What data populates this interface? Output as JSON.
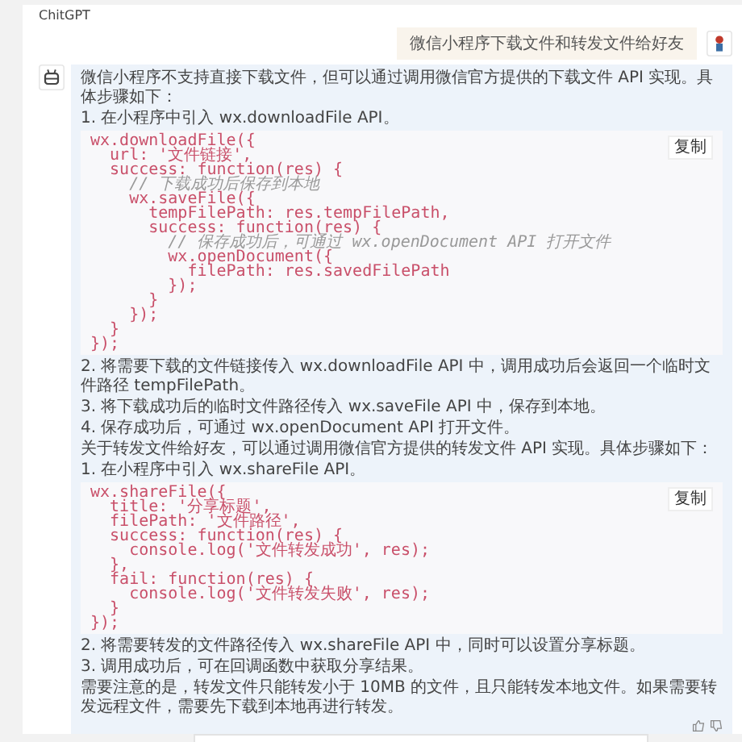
{
  "header": {
    "title": "ChitGPT"
  },
  "user_message": {
    "text": "微信小程序下载文件和转发文件给好友"
  },
  "reply": {
    "blocks": [
      {
        "kind": "text",
        "text": "微信小程序不支持直接下载文件，但可以通过调用微信官方提供的下载文件 API 实现。具体步骤如下："
      },
      {
        "kind": "text",
        "text": "1. 在小程序中引入 wx.downloadFile API。"
      },
      {
        "kind": "code",
        "copy_label": "复制",
        "lines": [
          {
            "kind": "code",
            "text": "wx.downloadFile({"
          },
          {
            "kind": "code",
            "text": "  url: '文件链接',"
          },
          {
            "kind": "code",
            "text": "  success: function(res) {"
          },
          {
            "kind": "comment",
            "text": "    // 下载成功后保存到本地"
          },
          {
            "kind": "code",
            "text": "    wx.saveFile({"
          },
          {
            "kind": "code",
            "text": "      tempFilePath: res.tempFilePath,"
          },
          {
            "kind": "code",
            "text": "      success: function(res) {"
          },
          {
            "kind": "comment",
            "text": "        // 保存成功后，可通过 wx.openDocument API 打开文件"
          },
          {
            "kind": "code",
            "text": "        wx.openDocument({"
          },
          {
            "kind": "code",
            "text": "          filePath: res.savedFilePath"
          },
          {
            "kind": "code",
            "text": "        });"
          },
          {
            "kind": "code",
            "text": "      }"
          },
          {
            "kind": "code",
            "text": "    });"
          },
          {
            "kind": "code",
            "text": "  }"
          },
          {
            "kind": "code",
            "text": "});"
          }
        ]
      },
      {
        "kind": "text",
        "text": "2. 将需要下载的文件链接传入 wx.downloadFile API 中，调用成功后会返回一个临时文件路径 tempFilePath。"
      },
      {
        "kind": "text",
        "text": "3. 将下载成功后的临时文件路径传入 wx.saveFile API 中，保存到本地。"
      },
      {
        "kind": "text",
        "text": "4. 保存成功后，可通过 wx.openDocument API 打开文件。"
      },
      {
        "kind": "text",
        "text": "关于转发文件给好友，可以通过调用微信官方提供的转发文件 API 实现。具体步骤如下："
      },
      {
        "kind": "text",
        "text": "1. 在小程序中引入 wx.shareFile API。"
      },
      {
        "kind": "code",
        "copy_label": "复制",
        "lines": [
          {
            "kind": "code",
            "text": "wx.shareFile({"
          },
          {
            "kind": "code",
            "text": "  title: '分享标题',"
          },
          {
            "kind": "code",
            "text": "  filePath: '文件路径',"
          },
          {
            "kind": "code",
            "text": "  success: function(res) {"
          },
          {
            "kind": "code",
            "text": "    console.log('文件转发成功', res);"
          },
          {
            "kind": "code",
            "text": "  },"
          },
          {
            "kind": "code",
            "text": "  fail: function(res) {"
          },
          {
            "kind": "code",
            "text": "    console.log('文件转发失败', res);"
          },
          {
            "kind": "code",
            "text": "  }"
          },
          {
            "kind": "code",
            "text": "});"
          }
        ]
      },
      {
        "kind": "text",
        "text": "2. 将需要转发的文件路径传入 wx.shareFile API 中，同时可以设置分享标题。"
      },
      {
        "kind": "text",
        "text": "3. 调用成功后，可在回调函数中获取分享结果。"
      },
      {
        "kind": "text",
        "text": "需要注意的是，转发文件只能转发小于 10MB 的文件，且只能转发本地文件。如果需要转发远程文件，需要先下载到本地再进行转发。"
      }
    ]
  }
}
